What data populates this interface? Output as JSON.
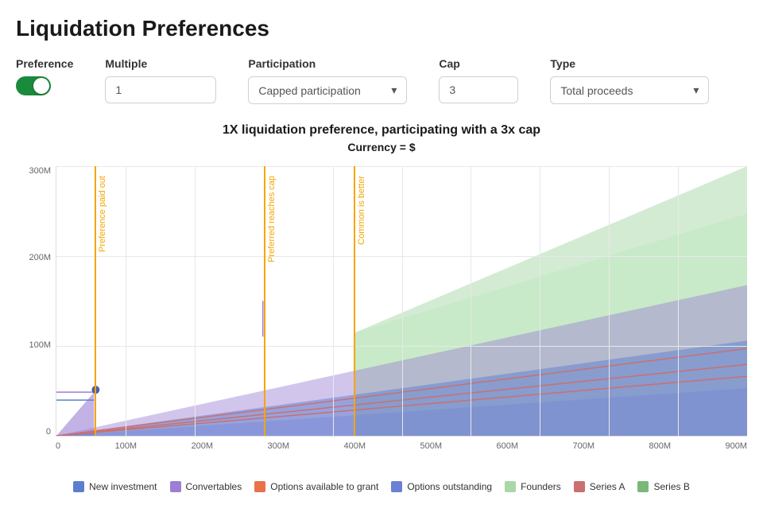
{
  "page": {
    "title": "Liquidation Preferences"
  },
  "controls": {
    "preference_label": "Preference",
    "multiple_label": "Multiple",
    "multiple_value": "1",
    "participation_label": "Participation",
    "participation_value": "Capped participation",
    "cap_label": "Cap",
    "cap_value": "3",
    "type_label": "Type",
    "type_value": "Total proceeds"
  },
  "chart": {
    "title": "1X liquidation preference, participating with a 3x cap",
    "subtitle": "Currency = $",
    "y_labels": [
      "300M",
      "200M",
      "100M",
      "0"
    ],
    "x_labels": [
      "0",
      "100M",
      "200M",
      "300M",
      "400M",
      "500M",
      "600M",
      "700M",
      "800M",
      "900M"
    ],
    "vlines": [
      {
        "label": "Preference paid out",
        "x_pct": 5.5
      },
      {
        "label": "Preferred reaches cap",
        "x_pct": 30
      },
      {
        "label": "Common is better",
        "x_pct": 43
      }
    ]
  },
  "legend": [
    {
      "name": "New investment",
      "color": "#5b7fce"
    },
    {
      "name": "Convertables",
      "color": "#9b7fd4"
    },
    {
      "name": "Options available to grant",
      "color": "#e8724a"
    },
    {
      "name": "Options outstanding",
      "color": "#6b7fd4"
    },
    {
      "name": "Founders",
      "color": "#a8d8a8"
    },
    {
      "name": "Series A",
      "color": "#c97070"
    },
    {
      "name": "Series B",
      "color": "#7ab87a"
    }
  ],
  "icons": {
    "chevron_down": "▾",
    "toggle_on": ""
  }
}
